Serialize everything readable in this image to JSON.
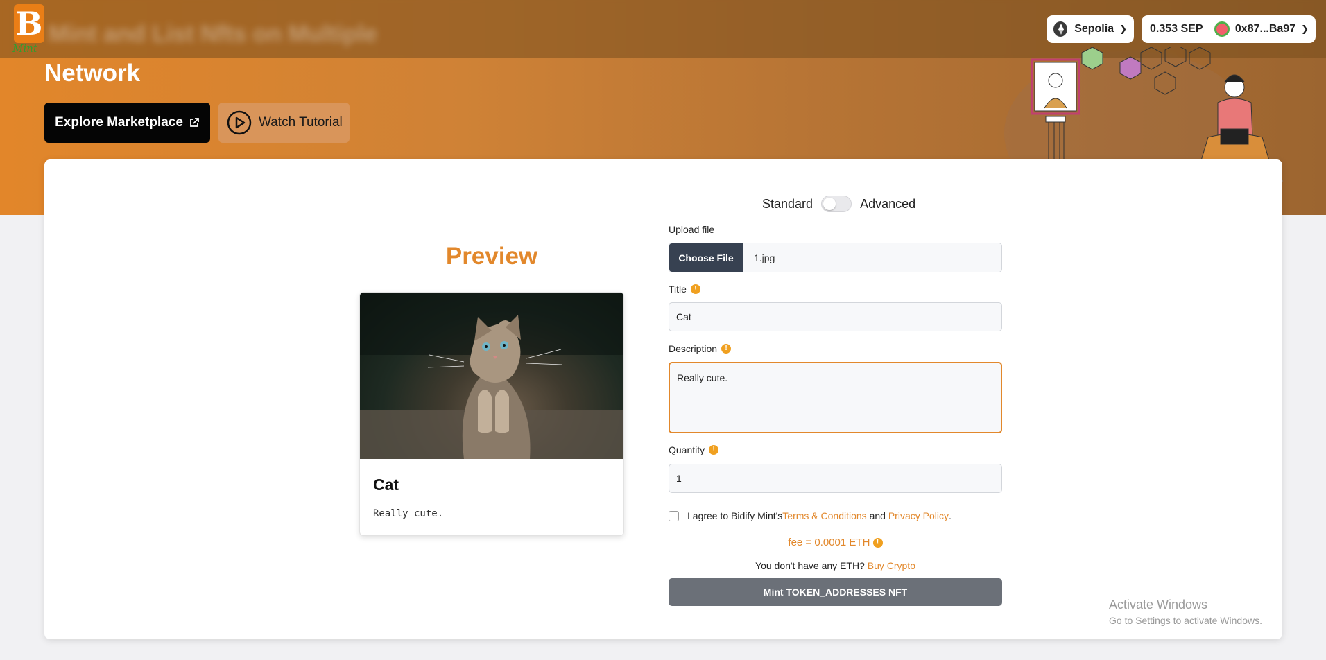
{
  "header": {
    "logo_sub": "Mint",
    "blurred_title": "Mint and List Nfts on Multiple",
    "network": "Sepolia",
    "balance": "0.353 SEP",
    "wallet_address": "0x87...Ba97"
  },
  "hero": {
    "title": "Network",
    "explore_button": "Explore Marketplace",
    "tutorial_button": "Watch Tutorial"
  },
  "mode_toggle": {
    "left_label": "Standard",
    "right_label": "Advanced",
    "advanced_enabled": false
  },
  "preview": {
    "heading": "Preview",
    "card_title": "Cat",
    "card_description": "Really cute."
  },
  "form": {
    "upload_label": "Upload file",
    "choose_file_button": "Choose File",
    "file_name": "1.jpg",
    "title_label": "Title",
    "title_value": "Cat",
    "description_label": "Description",
    "description_value": "Really cute.",
    "quantity_label": "Quantity",
    "quantity_value": "1",
    "agree_prefix": "I agree to Bidify Mint's ",
    "terms_link": "Terms & Conditions",
    "agree_and": " and ",
    "privacy_link": "Privacy Policy",
    "agree_suffix": ".",
    "fee_text": "fee = 0.0001 ETH",
    "no_eth_text": "You don't have any ETH? ",
    "buy_crypto_link": "Buy Crypto",
    "mint_button": "Mint TOKEN_ADDRESSES NFT"
  },
  "watermark": {
    "line1": "Activate Windows",
    "line2": "Go to Settings to activate Windows."
  },
  "colors": {
    "accent": "#e2882c",
    "mint_button": "#6b7078",
    "choose_button": "#374151"
  }
}
